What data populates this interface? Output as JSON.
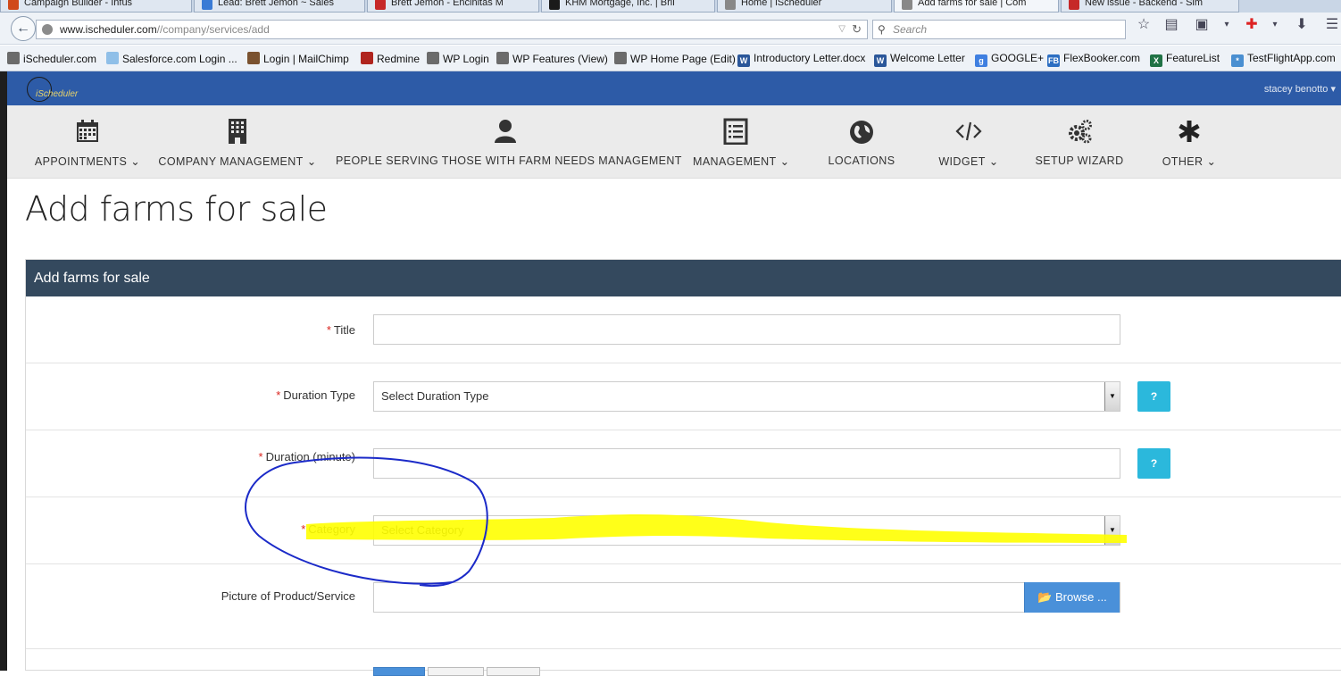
{
  "browser": {
    "tabs": [
      {
        "title": "Campaign Builder - Infus",
        "icon_color": "#d04a1a"
      },
      {
        "title": "Lead: Brett Jemon ~ Sales",
        "icon_color": "#3a7bd5"
      },
      {
        "title": "Brett Jemon - Encinitas M",
        "icon_color": "#c62828"
      },
      {
        "title": "KHM Mortgage, Inc. | Bril",
        "icon_color": "#1a1a1a"
      },
      {
        "title": "Home | iScheduler",
        "icon_color": "#888888"
      },
      {
        "title": "Add farms for sale | Com",
        "icon_color": "#888888"
      },
      {
        "title": "New issue - Backend - Sim",
        "icon_color": "#c62828"
      }
    ],
    "url_domain": "www.ischeduler.com",
    "url_path": "//company/services/add",
    "search_placeholder": "Search",
    "back_icon": "back-arrow-icon",
    "reload_icon": "reload-icon",
    "bookmarks": [
      {
        "label": "iScheduler.com",
        "icon_color": "#6b6b6b",
        "icon_text": ""
      },
      {
        "label": "Salesforce.com Login ...",
        "icon_color": "#8fbfe8",
        "icon_text": ""
      },
      {
        "label": "Login | MailChimp",
        "icon_color": "#7a5230",
        "icon_text": ""
      },
      {
        "label": "Redmine",
        "icon_color": "#b0241e",
        "icon_text": ""
      },
      {
        "label": "WP Login",
        "icon_color": "#6b6b6b",
        "icon_text": ""
      },
      {
        "label": "WP Features (View)",
        "icon_color": "#6b6b6b",
        "icon_text": ""
      },
      {
        "label": "WP Home Page (Edit)",
        "icon_color": "#6b6b6b",
        "icon_text": ""
      },
      {
        "label": "Introductory Letter.docx",
        "icon_color": "#2b579a",
        "icon_text": "W"
      },
      {
        "label": "Welcome Letter",
        "icon_color": "#2b579a",
        "icon_text": "W"
      },
      {
        "label": "GOOGLE+",
        "icon_color": "#3f7fe0",
        "icon_text": "g"
      },
      {
        "label": "FlexBooker.com",
        "icon_color": "#2d6fc2",
        "icon_text": "FB"
      },
      {
        "label": "FeatureList",
        "icon_color": "#207245",
        "icon_text": "X"
      },
      {
        "label": "TestFlightApp.com",
        "icon_color": "#4a8fd1",
        "icon_text": "*"
      }
    ]
  },
  "app": {
    "brand": "iScheduler",
    "user_menu": "stacey benotto",
    "user_caret": "▾",
    "nav": [
      {
        "label": "APPOINTMENTS",
        "caret": "⌄",
        "icon": "calendar-icon"
      },
      {
        "label": "COMPANY MANAGEMENT",
        "caret": "⌄",
        "icon": "building-icon"
      },
      {
        "label": "PEOPLE SERVING THOSE WITH FARM NEEDS MANAGEMENT",
        "caret": "",
        "icon": "person-icon"
      },
      {
        "label": "MANAGEMENT",
        "caret": "⌄",
        "icon": "list-icon"
      },
      {
        "label": "LOCATIONS",
        "caret": "",
        "icon": "globe-icon"
      },
      {
        "label": "WIDGET",
        "caret": "⌄",
        "icon": "code-icon"
      },
      {
        "label": "SETUP WIZARD",
        "caret": "",
        "icon": "gears-icon"
      },
      {
        "label": "OTHER",
        "caret": "⌄",
        "icon": "asterisk-icon"
      }
    ]
  },
  "page": {
    "title": "Add farms for sale",
    "panel_title": "Add farms for sale"
  },
  "form": {
    "required_mark": "*",
    "title_label": "Title",
    "title_value": "",
    "duration_type_label": "Duration Type",
    "duration_type_value": "Select Duration Type",
    "duration_label": "Duration (minute)",
    "duration_value": "",
    "category_label": "Category",
    "category_value": "Select Category",
    "picture_label": "Picture of Product/Service",
    "browse_label": "Browse ...",
    "help_label": "?",
    "select_arrow": "▼"
  },
  "annotations": {
    "circle_color": "#1b2ac8",
    "highlight_color": "#ffff00"
  }
}
